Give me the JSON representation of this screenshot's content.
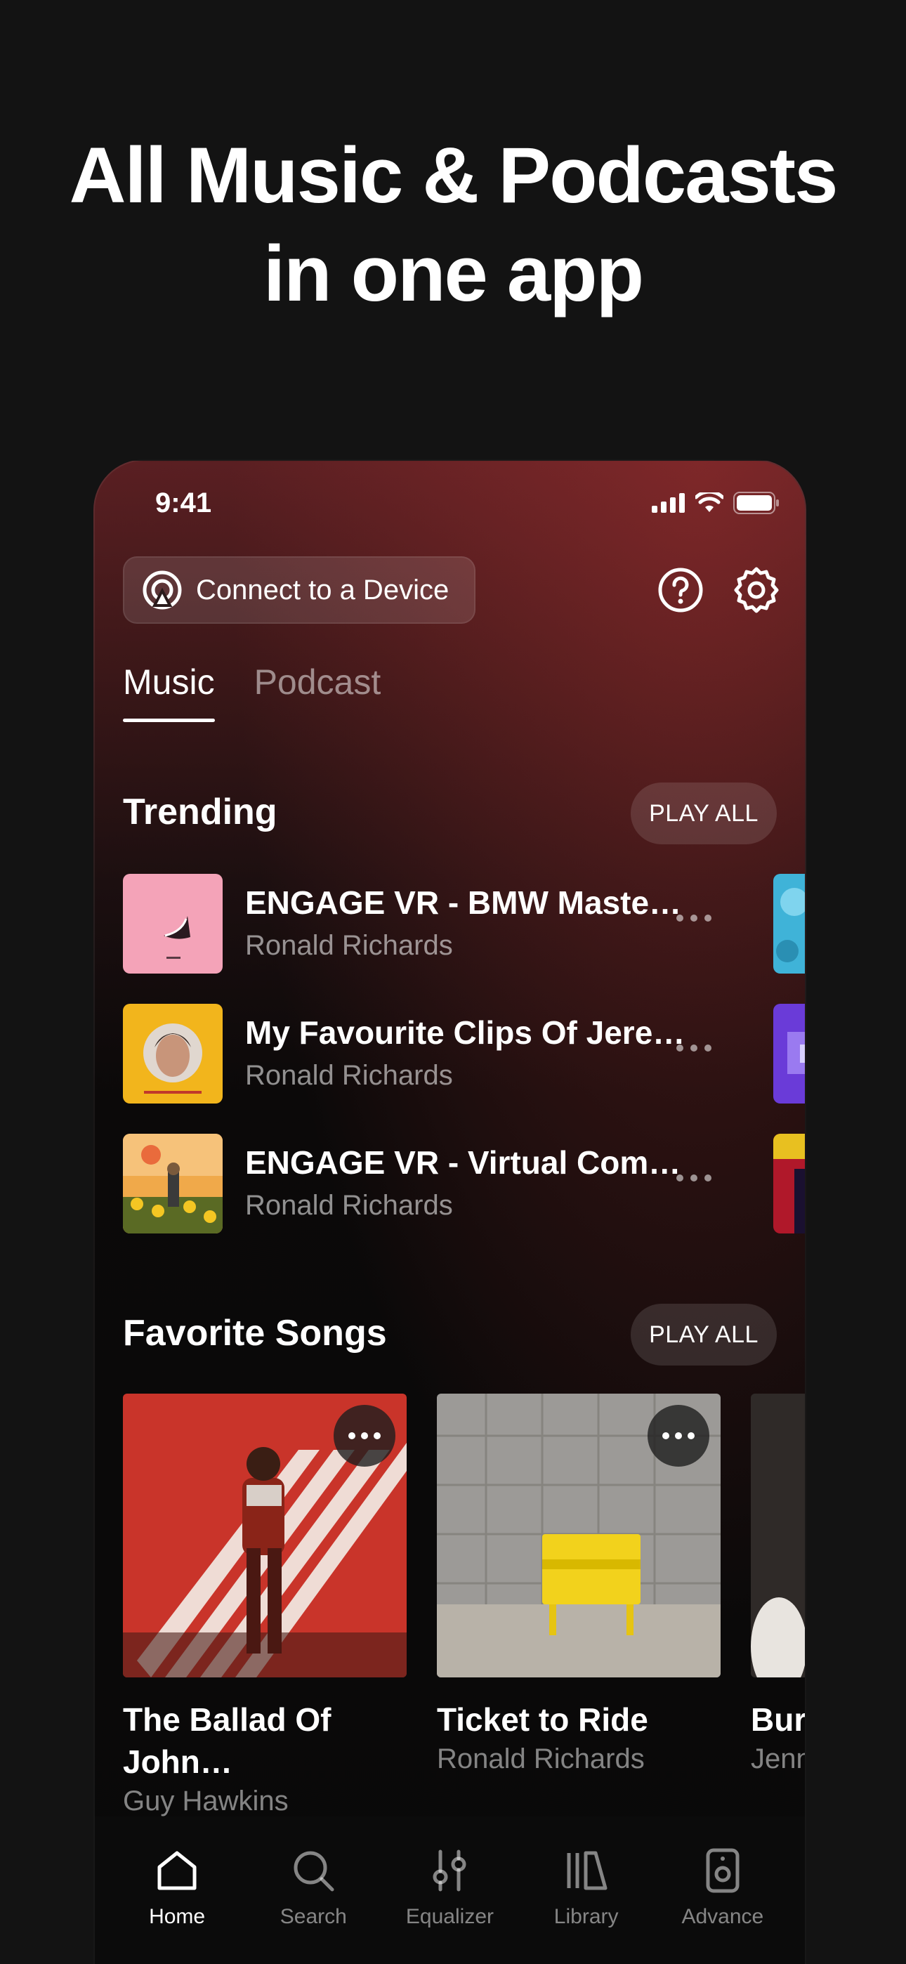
{
  "headline": {
    "line1": "All Music & Podcasts",
    "line2": "in one app"
  },
  "status_bar": {
    "time": "9:41"
  },
  "connect": {
    "label": "Connect to a Device"
  },
  "tabs": [
    {
      "label": "Music",
      "active": true
    },
    {
      "label": "Podcast",
      "active": false
    }
  ],
  "trending": {
    "title": "Trending",
    "play_all": "PLAY ALL",
    "tracks": [
      {
        "title": "ENGAGE VR - BMW Maste…",
        "artist": "Ronald Richards"
      },
      {
        "title": "My Favourite Clips Of Jere…",
        "artist": "Ronald Richards"
      },
      {
        "title": "ENGAGE VR - Virtual Com…",
        "artist": "Ronald Richards"
      }
    ]
  },
  "favorites": {
    "title": "Favorite Songs",
    "play_all": "PLAY ALL",
    "cards": [
      {
        "title": "The Ballad Of John…",
        "artist": "Guy Hawkins"
      },
      {
        "title": "Ticket to Ride",
        "artist": "Ronald Richards"
      },
      {
        "title": "Burn the…",
        "artist": "Jenn"
      }
    ]
  },
  "nav": [
    {
      "label": "Home",
      "icon": "home-icon",
      "active": true
    },
    {
      "label": "Search",
      "icon": "search-icon",
      "active": false
    },
    {
      "label": "Equalizer",
      "icon": "equalizer-icon",
      "active": false
    },
    {
      "label": "Library",
      "icon": "library-icon",
      "active": false
    },
    {
      "label": "Advance",
      "icon": "speaker-icon",
      "active": false
    }
  ],
  "colors": {
    "background": "#131313",
    "accent_gradient_top": "#5a1f22",
    "nav_bg": "#0b0b0b"
  }
}
